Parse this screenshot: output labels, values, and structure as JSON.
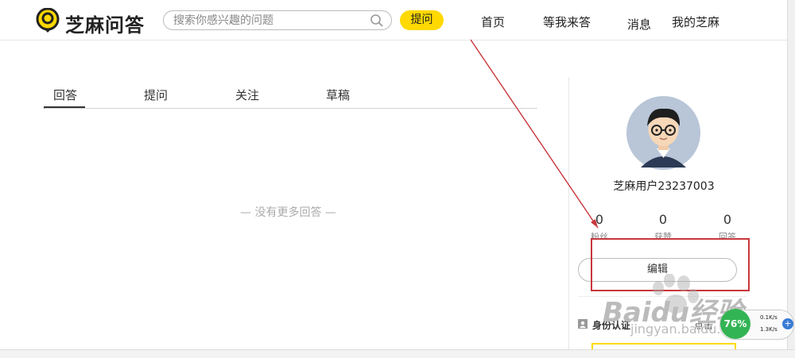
{
  "header": {
    "logo_text": "芝麻问答",
    "search_placeholder": "搜索你感兴趣的问题",
    "ask_label": "提问",
    "nav": [
      "首页",
      "等我来答",
      "消息",
      "我的芝麻"
    ]
  },
  "tabs": [
    "回答",
    "提问",
    "关注",
    "草稿"
  ],
  "empty_message": "— 没有更多回答 —",
  "profile": {
    "username": "芝麻用户23237003",
    "stats": [
      {
        "value": "0",
        "label": "粉丝"
      },
      {
        "value": "0",
        "label": "获赞"
      },
      {
        "value": "0",
        "label": "回答"
      }
    ],
    "edit_label": "编辑",
    "identity_label": "身份认证",
    "identity_link": "点击"
  },
  "watermark": {
    "brand": "Baidu经验",
    "url": "jingyan.baidu.com"
  },
  "network_widget": {
    "percent": "76%",
    "upload": "0.1K/s",
    "download": "1.3K/s"
  },
  "colors": {
    "accent": "#ffd900",
    "annotation": "#c8373b",
    "network": "#33b454"
  }
}
